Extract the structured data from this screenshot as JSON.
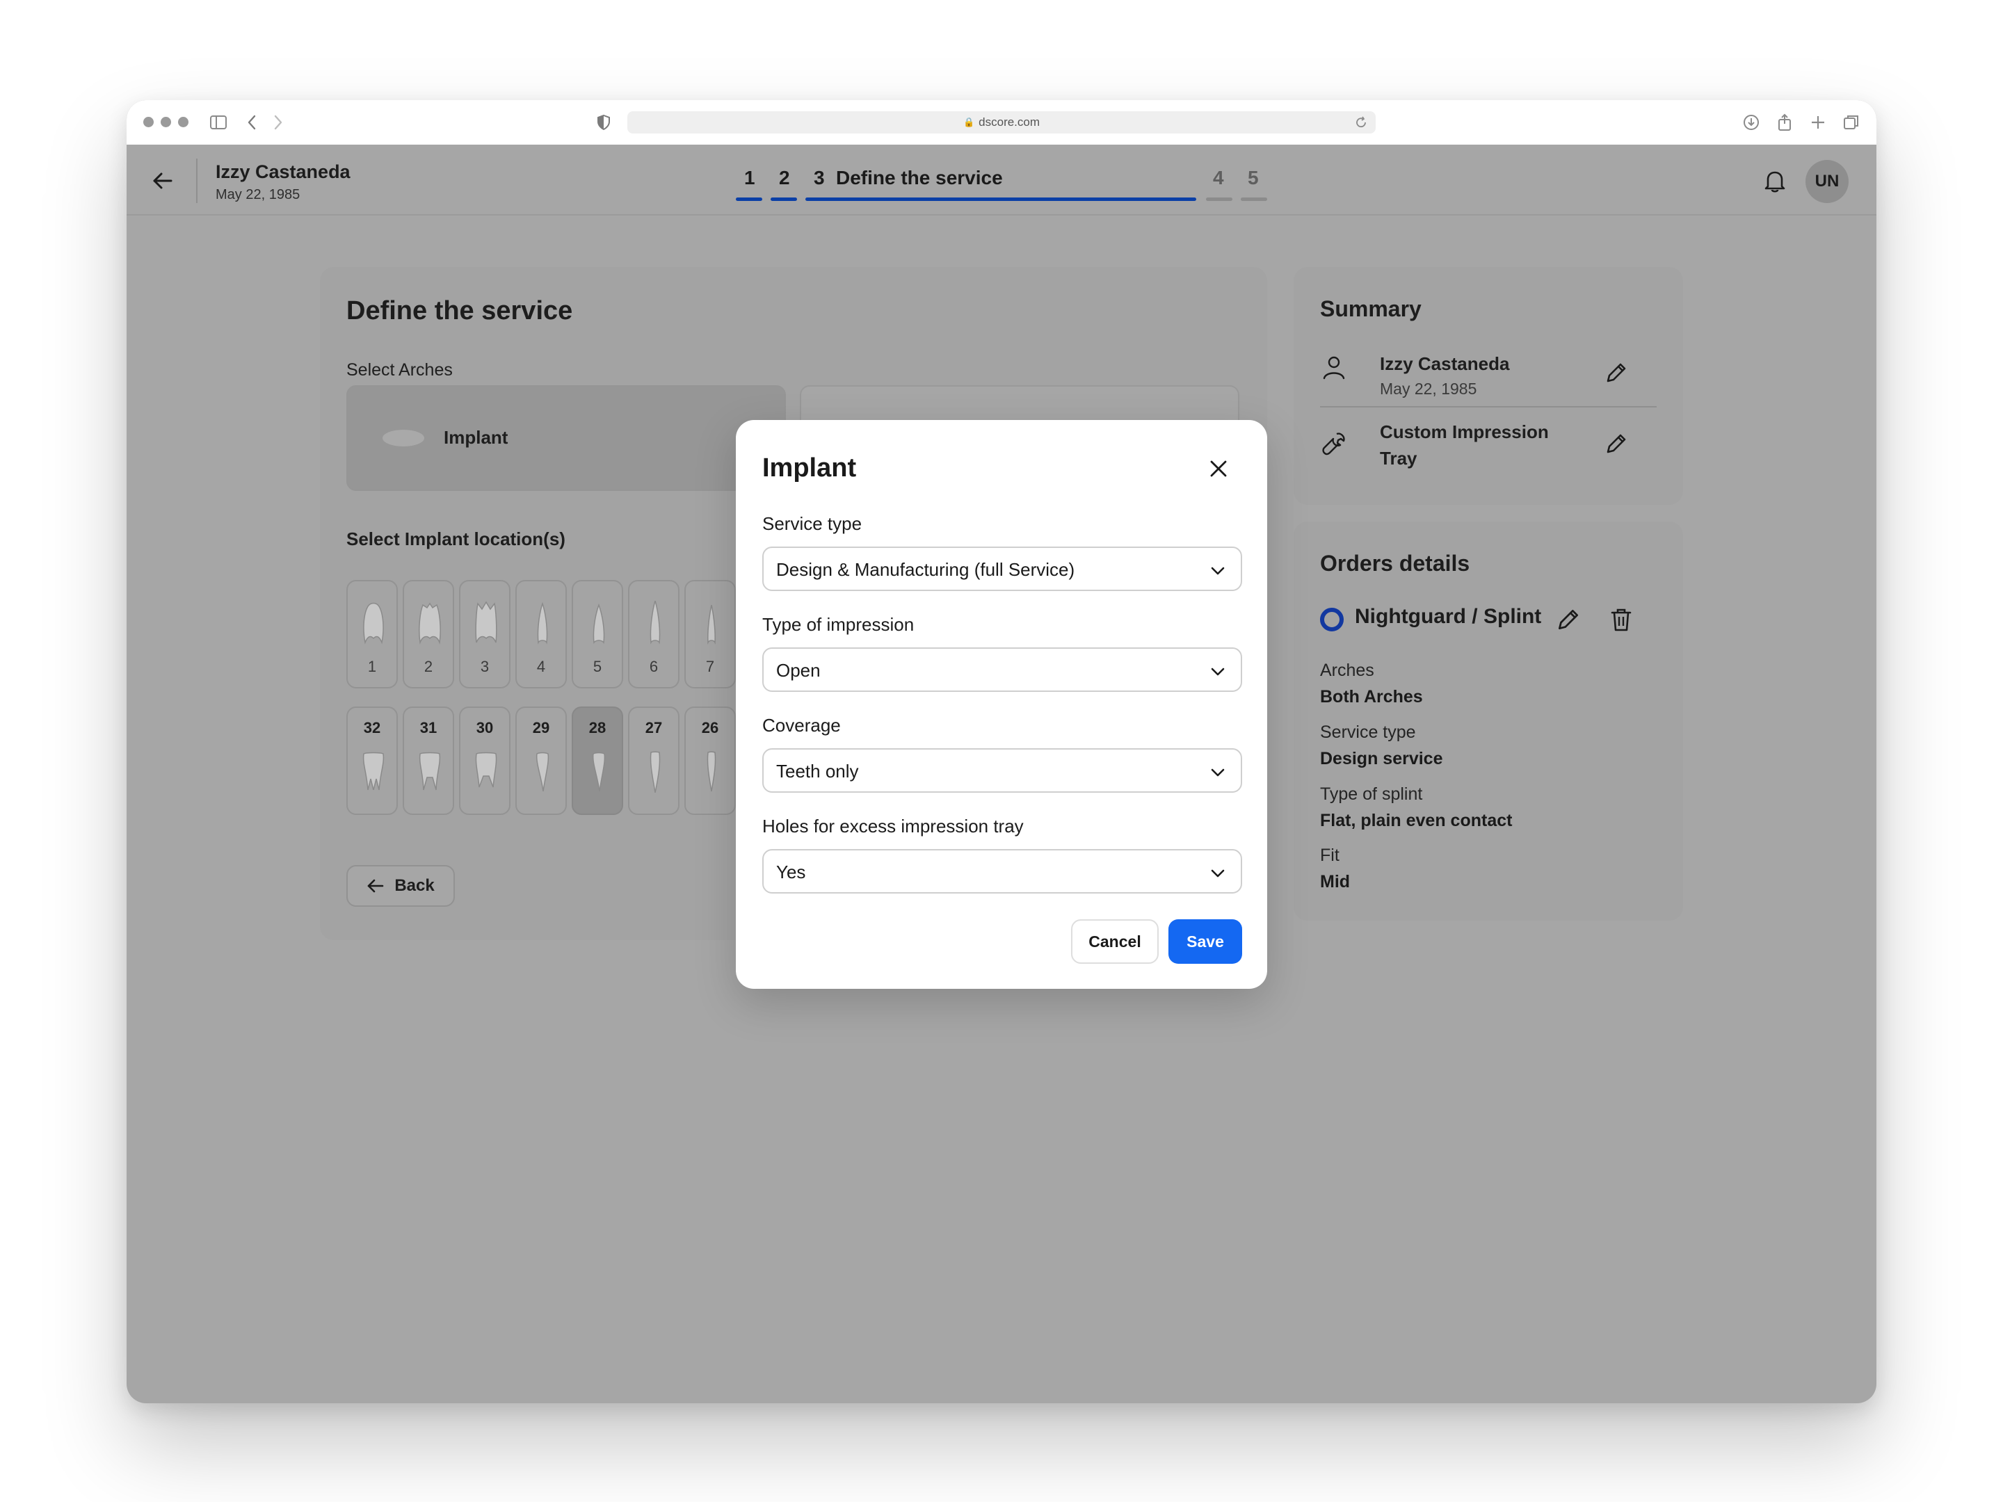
{
  "browser": {
    "url": "dscore.com"
  },
  "header": {
    "patient_name": "Izzy Castaneda",
    "patient_dob": "May 22, 1985",
    "steps": [
      {
        "label": "1"
      },
      {
        "label": "2"
      },
      {
        "label": "3",
        "title": "Define the service"
      },
      {
        "label": "4"
      },
      {
        "label": "5"
      }
    ],
    "current_step": 3,
    "avatar_initials": "UN"
  },
  "main": {
    "title": "Define the service",
    "select_arches_label": "Select Arches",
    "arch_option": "Implant",
    "implant_location_label": "Select Implant location(s)",
    "upper_teeth": [
      "1",
      "2",
      "3",
      "4",
      "5",
      "6",
      "7"
    ],
    "lower_teeth": [
      "32",
      "31",
      "30",
      "29",
      "28",
      "27",
      "26"
    ],
    "selected_tooth": "28",
    "back_label": "Back"
  },
  "summary": {
    "title": "Summary",
    "patient_name": "Izzy Castaneda",
    "patient_dob": "May 22, 1985",
    "service_line1": "Custom Impression",
    "service_line2": "Tray"
  },
  "orders": {
    "title": "Orders details",
    "item_name": "Nightguard / Splint",
    "fields": [
      {
        "label": "Arches",
        "value": "Both Arches"
      },
      {
        "label": "Service type",
        "value": "Design service"
      },
      {
        "label": "Type of splint",
        "value": "Flat, plain even contact"
      },
      {
        "label": "Fit",
        "value": "Mid"
      }
    ]
  },
  "modal": {
    "title": "Implant",
    "fields": [
      {
        "label": "Service type",
        "value": "Design & Manufacturing (full Service)"
      },
      {
        "label": "Type of impression",
        "value": "Open"
      },
      {
        "label": "Coverage",
        "value": "Teeth only"
      },
      {
        "label": "Holes for excess impression tray",
        "value": "Yes"
      }
    ],
    "cancel_label": "Cancel",
    "save_label": "Save"
  },
  "colors": {
    "primary": "#1468f2",
    "step_active": "#0b3fa6",
    "overlay": "#a6a6a6",
    "order_ring": "#1238a0"
  }
}
